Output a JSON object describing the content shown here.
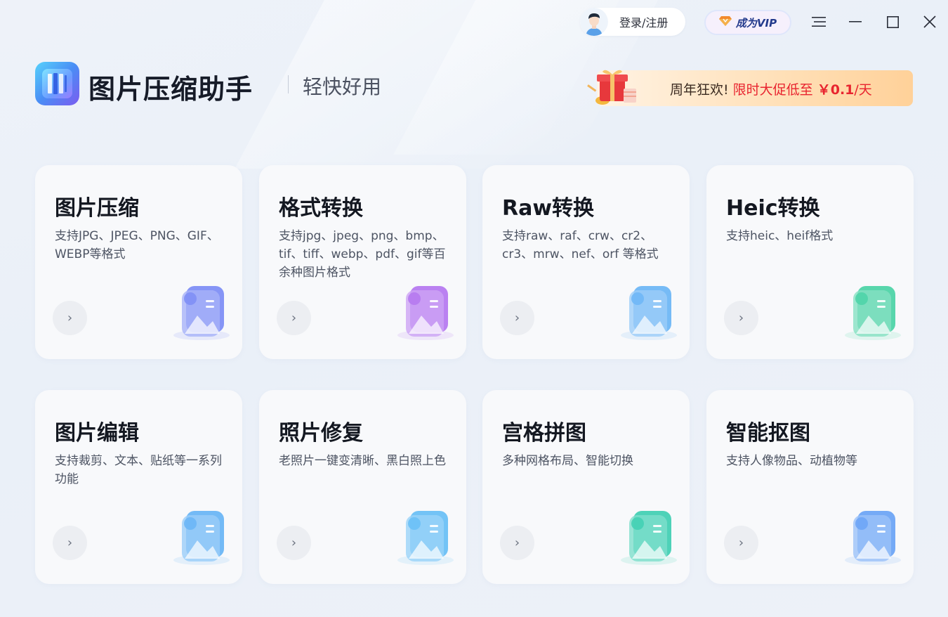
{
  "topbar": {
    "login_label": "登录/注册",
    "vip_label": "成为VIP",
    "icons": [
      "menu-icon",
      "minimize-icon",
      "maximize-icon",
      "close-icon"
    ]
  },
  "header": {
    "app_title": "图片压缩助手",
    "app_subtitle": "轻快好用",
    "promo": {
      "prefix": "周年狂欢!",
      "highlight": "限时大促低至",
      "price": "￥0.1",
      "suffix": "/天"
    }
  },
  "cards": [
    {
      "title": "图片压缩",
      "desc": "支持JPG、JPEG、PNG、GIF、WEBP等格式",
      "icon": "compress-icon",
      "color": "#7f8ff5"
    },
    {
      "title": "格式转换",
      "desc": "支持jpg、jpeg、png、bmp、tif、tiff、webp、pdf、gif等百余种图片格式",
      "icon": "convert-icon",
      "color": "#b67af0"
    },
    {
      "title": "Raw转换",
      "desc": "支持raw、raf、crw、cr2、cr3、mrw、nef、orf 等格式",
      "icon": "raw-icon",
      "color": "#6fb7f6"
    },
    {
      "title": "Heic转换",
      "desc": "支持heic、heif格式",
      "icon": "heic-icon",
      "color": "#4fd4a8"
    },
    {
      "title": "图片编辑",
      "desc": "支持裁剪、文本、贴纸等一系列功能",
      "icon": "edit-icon",
      "color": "#6cb6f6"
    },
    {
      "title": "照片修复",
      "desc": "老照片一键变清晰、黑白照上色",
      "icon": "repair-icon",
      "color": "#6cc0f6"
    },
    {
      "title": "宫格拼图",
      "desc": "多种网格布局、智能切换",
      "icon": "grid-icon",
      "color": "#44d0b4"
    },
    {
      "title": "智能抠图",
      "desc": "支持人像物品、动植物等",
      "icon": "cutout-icon",
      "color": "#6ea5f6"
    }
  ],
  "arrow_glyph": "›"
}
